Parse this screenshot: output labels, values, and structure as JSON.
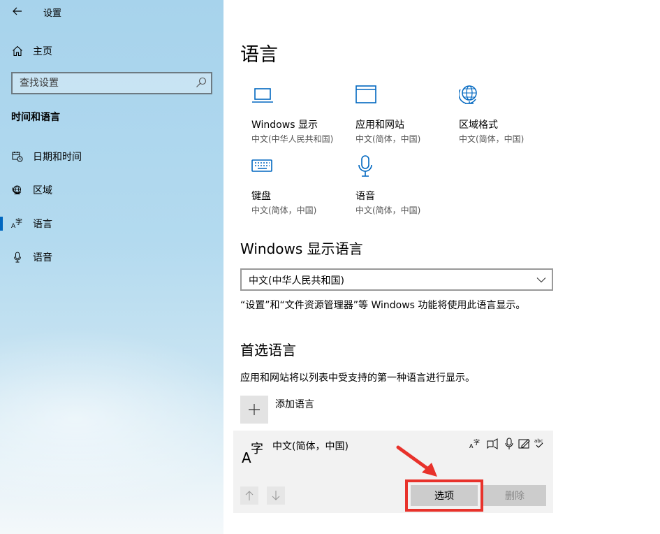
{
  "window": {
    "title": "设置"
  },
  "sidebar": {
    "home_label": "主页",
    "search": {
      "placeholder": "查找设置"
    },
    "section_title": "时间和语言",
    "items": [
      {
        "label": "日期和时间",
        "icon": "calendar-clock-icon"
      },
      {
        "label": "区域",
        "icon": "globe-icon"
      },
      {
        "label": "语言",
        "icon": "language-icon",
        "selected": true
      },
      {
        "label": "语音",
        "icon": "microphone-icon"
      }
    ]
  },
  "main": {
    "title": "语言",
    "tiles": [
      {
        "name": "Windows 显示",
        "sub": "中文(中华人民共和国)",
        "icon": "laptop-icon"
      },
      {
        "name": "应用和网站",
        "sub": "中文(简体，中国)",
        "icon": "browser-window-icon"
      },
      {
        "name": "区域格式",
        "sub": "中文(简体，中国)",
        "icon": "globe-format-icon"
      },
      {
        "name": "键盘",
        "sub": "中文(简体，中国)",
        "icon": "keyboard-icon"
      },
      {
        "name": "语音",
        "sub": "中文(简体，中国)",
        "icon": "microphone-icon"
      }
    ],
    "display_language": {
      "heading": "Windows 显示语言",
      "selected": "中文(中华人民共和国)",
      "description": "“设置”和“文件资源管理器”等 Windows 功能将使用此语言显示。"
    },
    "preferred": {
      "heading": "首选语言",
      "description": "应用和网站将以列表中受支持的第一种语言进行显示。",
      "add_label": "添加语言",
      "languages": [
        {
          "name": "中文(简体，中国)",
          "features": [
            "display-language-icon",
            "text-to-speech-icon",
            "speech-recognition-icon",
            "handwriting-icon",
            "spellcheck-icon"
          ],
          "options_label": "选项",
          "remove_label": "删除"
        }
      ]
    }
  },
  "colors": {
    "accent": "#0067c0",
    "highlight": "#e8322b"
  }
}
